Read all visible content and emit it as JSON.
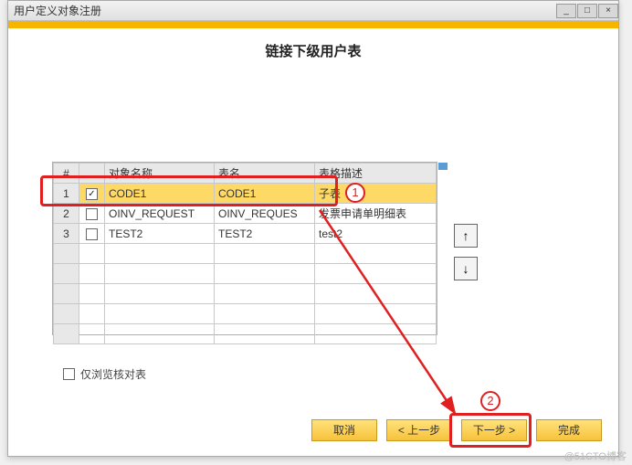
{
  "window": {
    "title": "用户定义对象注册"
  },
  "subtitle": "链接下级用户表",
  "table": {
    "headers": {
      "col1": "对象名称",
      "col2": "表名",
      "col3": "表格描述"
    },
    "rows": [
      {
        "num": "1",
        "checked": true,
        "obj": "CODE1",
        "tbl": "CODE1",
        "desc": "子表"
      },
      {
        "num": "2",
        "checked": false,
        "obj": "OINV_REQUEST",
        "tbl": "OINV_REQUES",
        "desc": "发票申请单明细表"
      },
      {
        "num": "3",
        "checked": false,
        "obj": "TEST2",
        "tbl": "TEST2",
        "desc": "test2"
      }
    ]
  },
  "browse_only_label": "仅浏览核对表",
  "buttons": {
    "cancel": "取消",
    "prev": "< 上一步",
    "next": "下一步 >",
    "finish": "完成"
  },
  "annotations": {
    "step1": "1",
    "step2": "2"
  },
  "watermark": "@51CTO博客"
}
